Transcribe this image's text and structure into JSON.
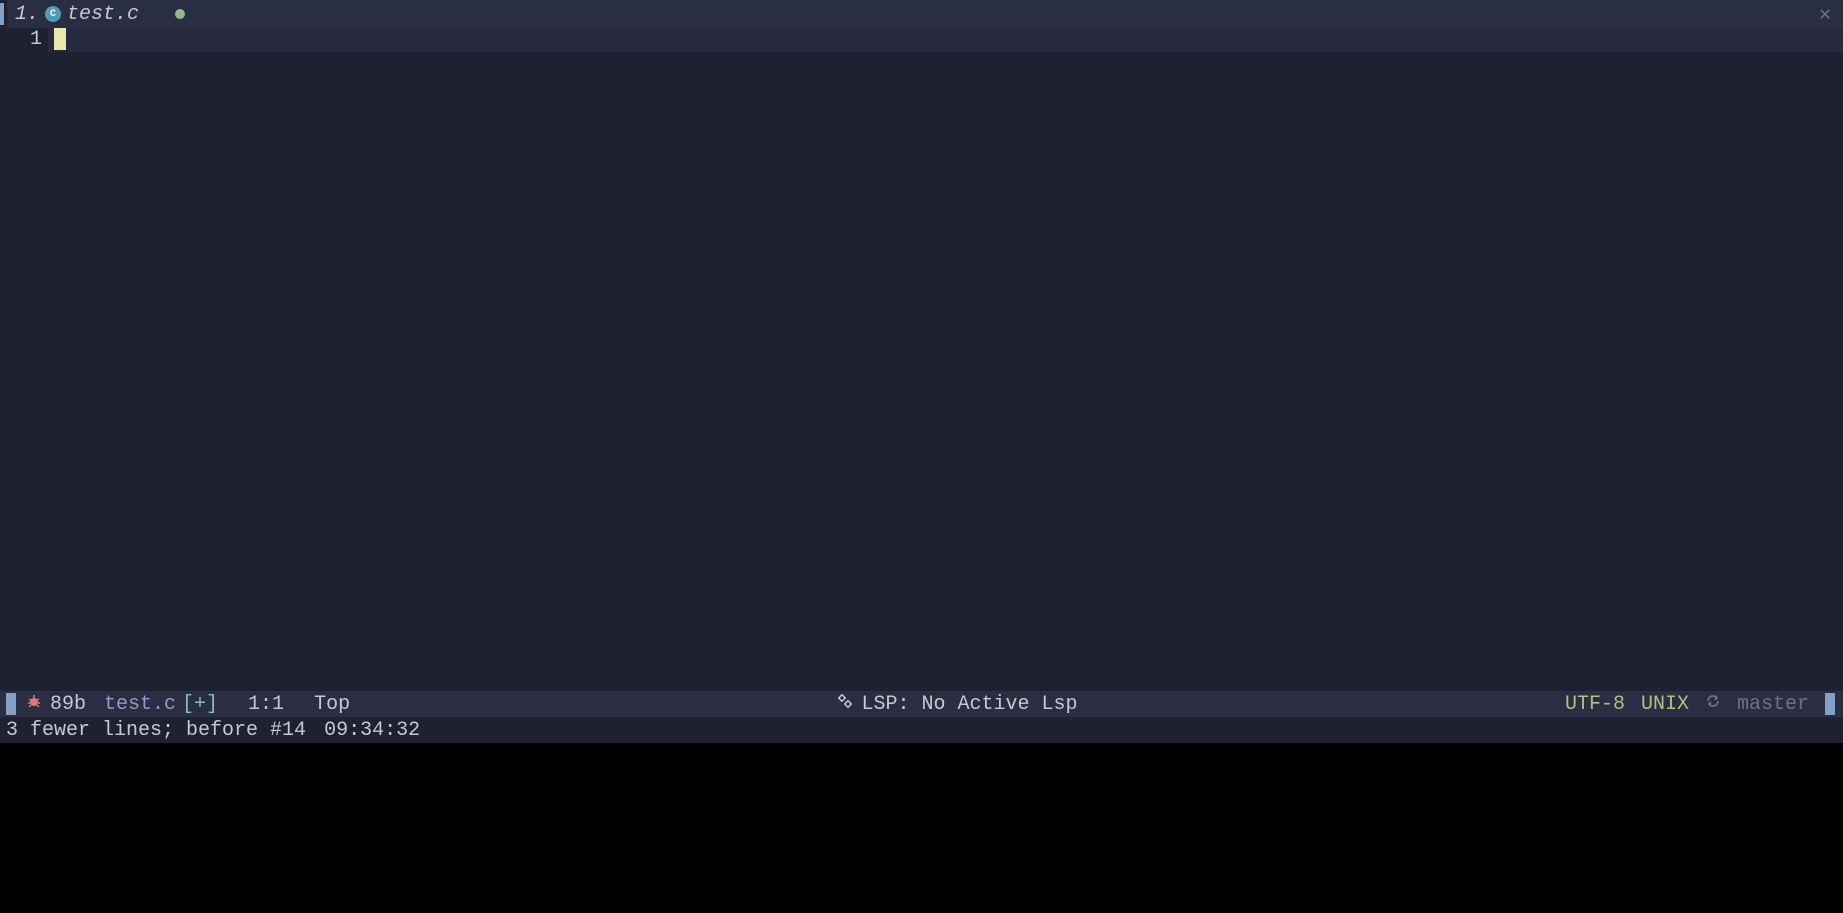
{
  "tab": {
    "number": "1.",
    "file_icon_letter": "C",
    "filename": "test.c"
  },
  "editor": {
    "line_number": "1"
  },
  "status": {
    "size": "89b",
    "filename": "test.c",
    "modified": "[+]",
    "position": "1:1",
    "scroll": "Top",
    "lsp": "LSP: No Active Lsp",
    "encoding": "UTF-8",
    "fileformat": "UNIX",
    "branch": "master"
  },
  "message": {
    "text": "3 fewer lines; before #14",
    "time": "09:34:32"
  }
}
